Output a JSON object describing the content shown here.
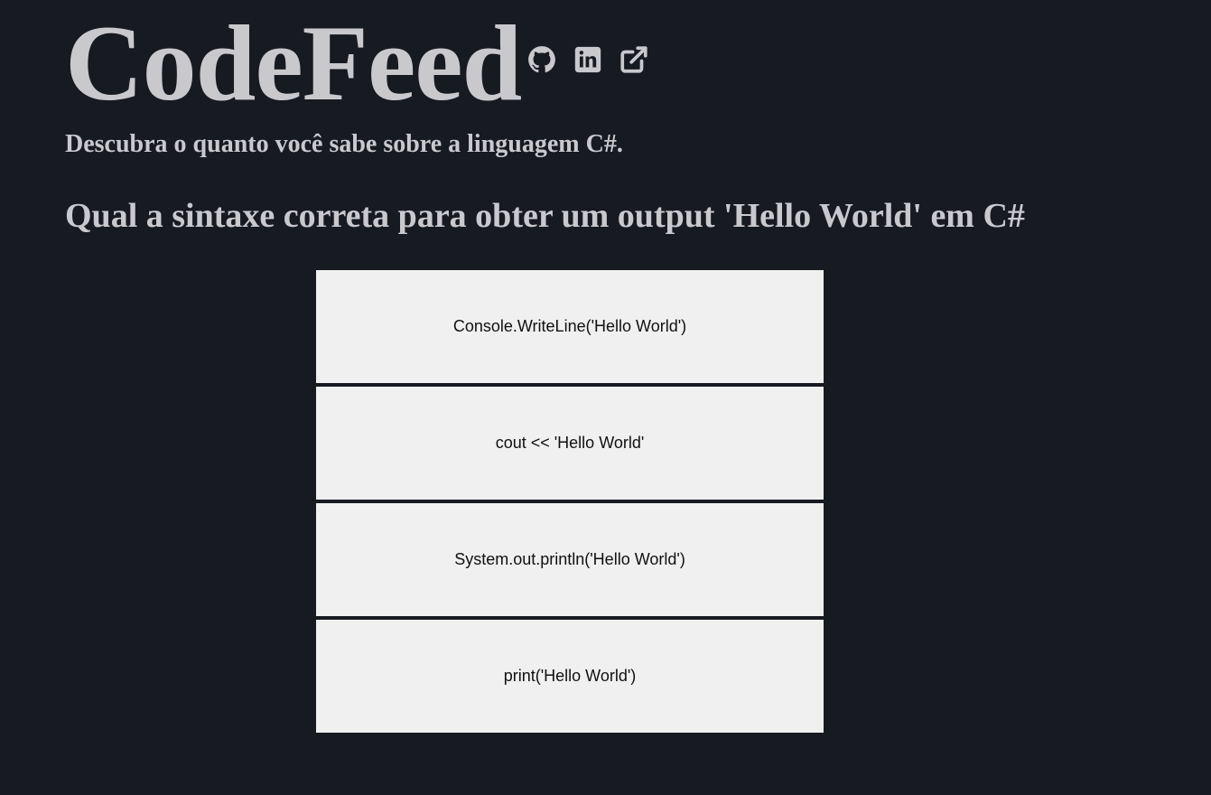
{
  "header": {
    "logo": "CodeFeed",
    "social_icons": [
      "github-icon",
      "linkedin-icon",
      "external-link-icon"
    ]
  },
  "subtitle": "Descubra o quanto você sabe sobre a linguagem C#.",
  "quiz": {
    "question": "Qual a sintaxe correta para obter um output 'Hello World' em C#",
    "answers": [
      {
        "label": "Console.WriteLine('Hello World')"
      },
      {
        "label": "cout << 'Hello World'"
      },
      {
        "label": "System.out.println('Hello World')"
      },
      {
        "label": "print('Hello World')"
      }
    ]
  },
  "colors": {
    "background": "#181a22",
    "text": "#c9c9cd",
    "answer_bg": "#f0f0f0",
    "answer_text": "#111111"
  }
}
